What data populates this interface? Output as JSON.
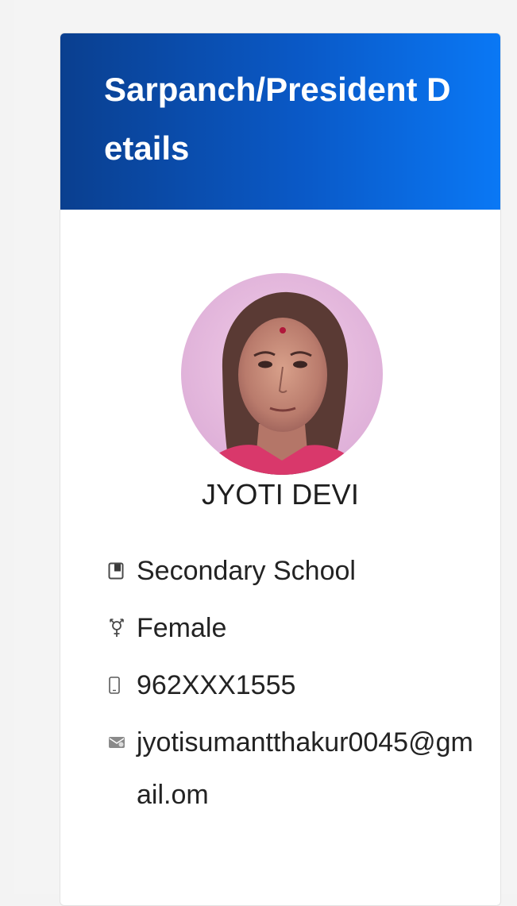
{
  "card": {
    "title": "Sarpanch/President Details"
  },
  "profile": {
    "name": "JYOTI DEVI",
    "avatar_alt": "profile-photo"
  },
  "details": {
    "education": {
      "icon": "book-icon",
      "text": "Secondary School"
    },
    "gender": {
      "icon": "gender-icon",
      "text": "Female"
    },
    "phone": {
      "icon": "mobile-phone-icon",
      "text": "962XXX1555"
    },
    "email": {
      "icon": "mail-icon",
      "text": "jyotisumantthakur0045@gmail.om"
    }
  },
  "colors": {
    "header_gradient_start": "#0a3f8f",
    "header_gradient_end": "#0a78f5",
    "page_background": "#f3f3f3",
    "card_background": "#ffffff"
  }
}
